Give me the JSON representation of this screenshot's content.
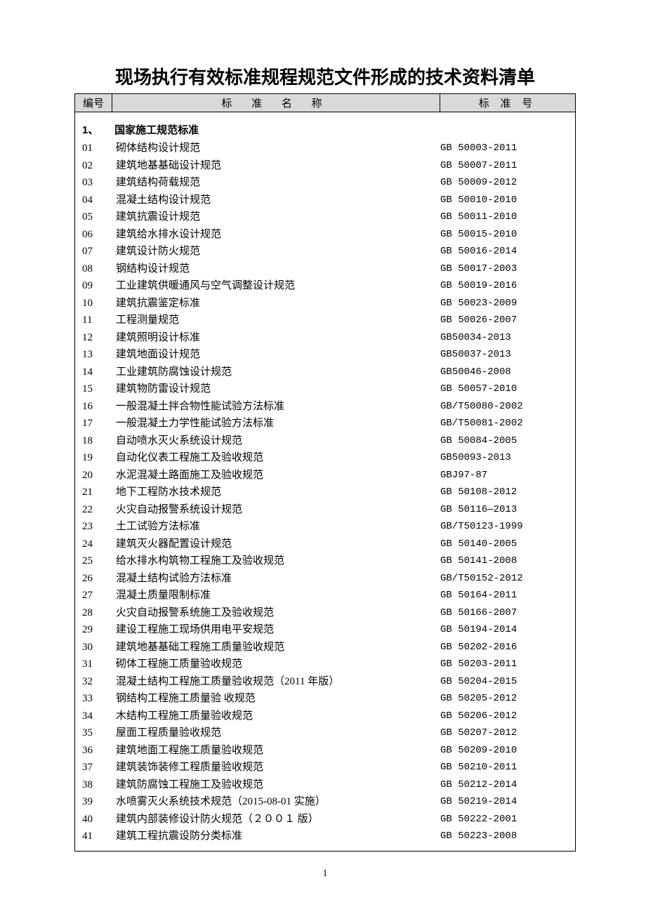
{
  "title": "现场执行有效标准规程规范文件形成的技术资料清单",
  "header": {
    "num": "编号",
    "name": "标 准 名 称",
    "code": "标 准 号"
  },
  "section": {
    "lead": "1、",
    "label": "国家施工规范标准"
  },
  "rows": [
    {
      "n": "01",
      "name": "砌体结构设计规范",
      "code": "GB 50003-2011"
    },
    {
      "n": "02",
      "name": "建筑地基基础设计规范",
      "code": "GB 50007-2011"
    },
    {
      "n": "03",
      "name": "建筑结构荷载规范",
      "code": "GB 50009-2012"
    },
    {
      "n": "04",
      "name": "混凝土结构设计规范",
      "code": "GB 50010-2010"
    },
    {
      "n": "05",
      "name": "建筑抗震设计规范",
      "code": "GB 50011-2010"
    },
    {
      "n": "06",
      "name": "建筑给水排水设计规范",
      "code": "GB 50015-2010"
    },
    {
      "n": "07",
      "name": "建筑设计防火规范",
      "code": "GB 50016-2014"
    },
    {
      "n": "08",
      "name": "钢结构设计规范",
      "code": "GB 50017-2003"
    },
    {
      "n": "09",
      "name": "工业建筑供暖通风与空气调整设计规范",
      "code": "GB 50019-2016"
    },
    {
      "n": "10",
      "name": "建筑抗震鉴定标准",
      "code": "GB 50023-2009"
    },
    {
      "n": "11",
      "name": "工程测量规范",
      "code": "GB 50026-2007"
    },
    {
      "n": "12",
      "name": "建筑照明设计标准",
      "code": "GB50034-2013"
    },
    {
      "n": "13",
      "name": "建筑地面设计规范",
      "code": "GB50037-2013"
    },
    {
      "n": "14",
      "name": "工业建筑防腐蚀设计规范",
      "code": "GB50046-2008"
    },
    {
      "n": "15",
      "name": "建筑物防雷设计规范",
      "code": "GB 50057-2010"
    },
    {
      "n": "16",
      "name": "一般混凝土拌合物性能试验方法标准",
      "code": "GB/T50080-2002"
    },
    {
      "n": "17",
      "name": "一般混凝土力学性能试验方法标准",
      "code": "GB/T50081-2002"
    },
    {
      "n": "18",
      "name": "自动喷水灭火系统设计规范",
      "code": "GB 50084-2005"
    },
    {
      "n": "19",
      "name": "自动化仪表工程施工及验收规范",
      "code": "GB50093-2013"
    },
    {
      "n": "20",
      "name": "水泥混凝土路面施工及验收规范",
      "code": "GBJ97-87"
    },
    {
      "n": "21",
      "name": "地下工程防水技术规范",
      "code": "GB 50108-2012"
    },
    {
      "n": "22",
      "name": "火灾自动报警系统设计规范",
      "code": "GB 50116—2013"
    },
    {
      "n": "23",
      "name": "土工试验方法标准",
      "code": "GB/T50123-1999"
    },
    {
      "n": "24",
      "name": "建筑灭火器配置设计规范",
      "code": "GB 50140-2005"
    },
    {
      "n": "25",
      "name": "给水排水构筑物工程施工及验收规范",
      "code": "GB 50141-2008"
    },
    {
      "n": "26",
      "name": "混凝土结构试验方法标准",
      "code": "GB/T50152-2012"
    },
    {
      "n": "27",
      "name": "混凝土质量限制标准",
      "code": "GB 50164-2011"
    },
    {
      "n": "28",
      "name": "火灾自动报警系统施工及验收规范",
      "code": "GB 50166-2007"
    },
    {
      "n": "29",
      "name": "建设工程施工现场供用电平安规范",
      "code": "GB 50194-2014"
    },
    {
      "n": "30",
      "name": "建筑地基基础工程施工质量验收规范",
      "code": "GB 50202-2016"
    },
    {
      "n": "31",
      "name": "砌体工程施工质量验收规范",
      "code": "GB 50203-2011"
    },
    {
      "n": "32",
      "name": "混凝土结构工程施工质量验收规范（2011 年版）",
      "code": "GB 50204-2015"
    },
    {
      "n": "33",
      "name": "钢结构工程施工质量验 收规范",
      "code": "GB 50205-2012"
    },
    {
      "n": "34",
      "name": "木结构工程施工质量验收规范",
      "code": "GB 50206-2012"
    },
    {
      "n": "35",
      "name": "屋面工程质量验收规范",
      "code": "GB 50207-2012"
    },
    {
      "n": "36",
      "name": "建筑地面工程施工质量验收规范",
      "code": "GB 50209-2010"
    },
    {
      "n": "37",
      "name": "建筑装饰装修工程质量验收规范",
      "code": "GB 50210-2011"
    },
    {
      "n": "38",
      "name": "建筑防腐蚀工程施工及验收规范",
      "code": "GB 50212-2014"
    },
    {
      "n": "39",
      "name": "水喷雾灭火系统技术规范（2015-08-01 实施）",
      "code": "GB 50219-2014"
    },
    {
      "n": "40",
      "name": "建筑内部装修设计防火规范（２００１ 版）",
      "code": "GB 50222-2001"
    },
    {
      "n": "41",
      "name": "建筑工程抗震设防分类标准",
      "code": "GB 50223-2008"
    }
  ],
  "page_number": "1"
}
